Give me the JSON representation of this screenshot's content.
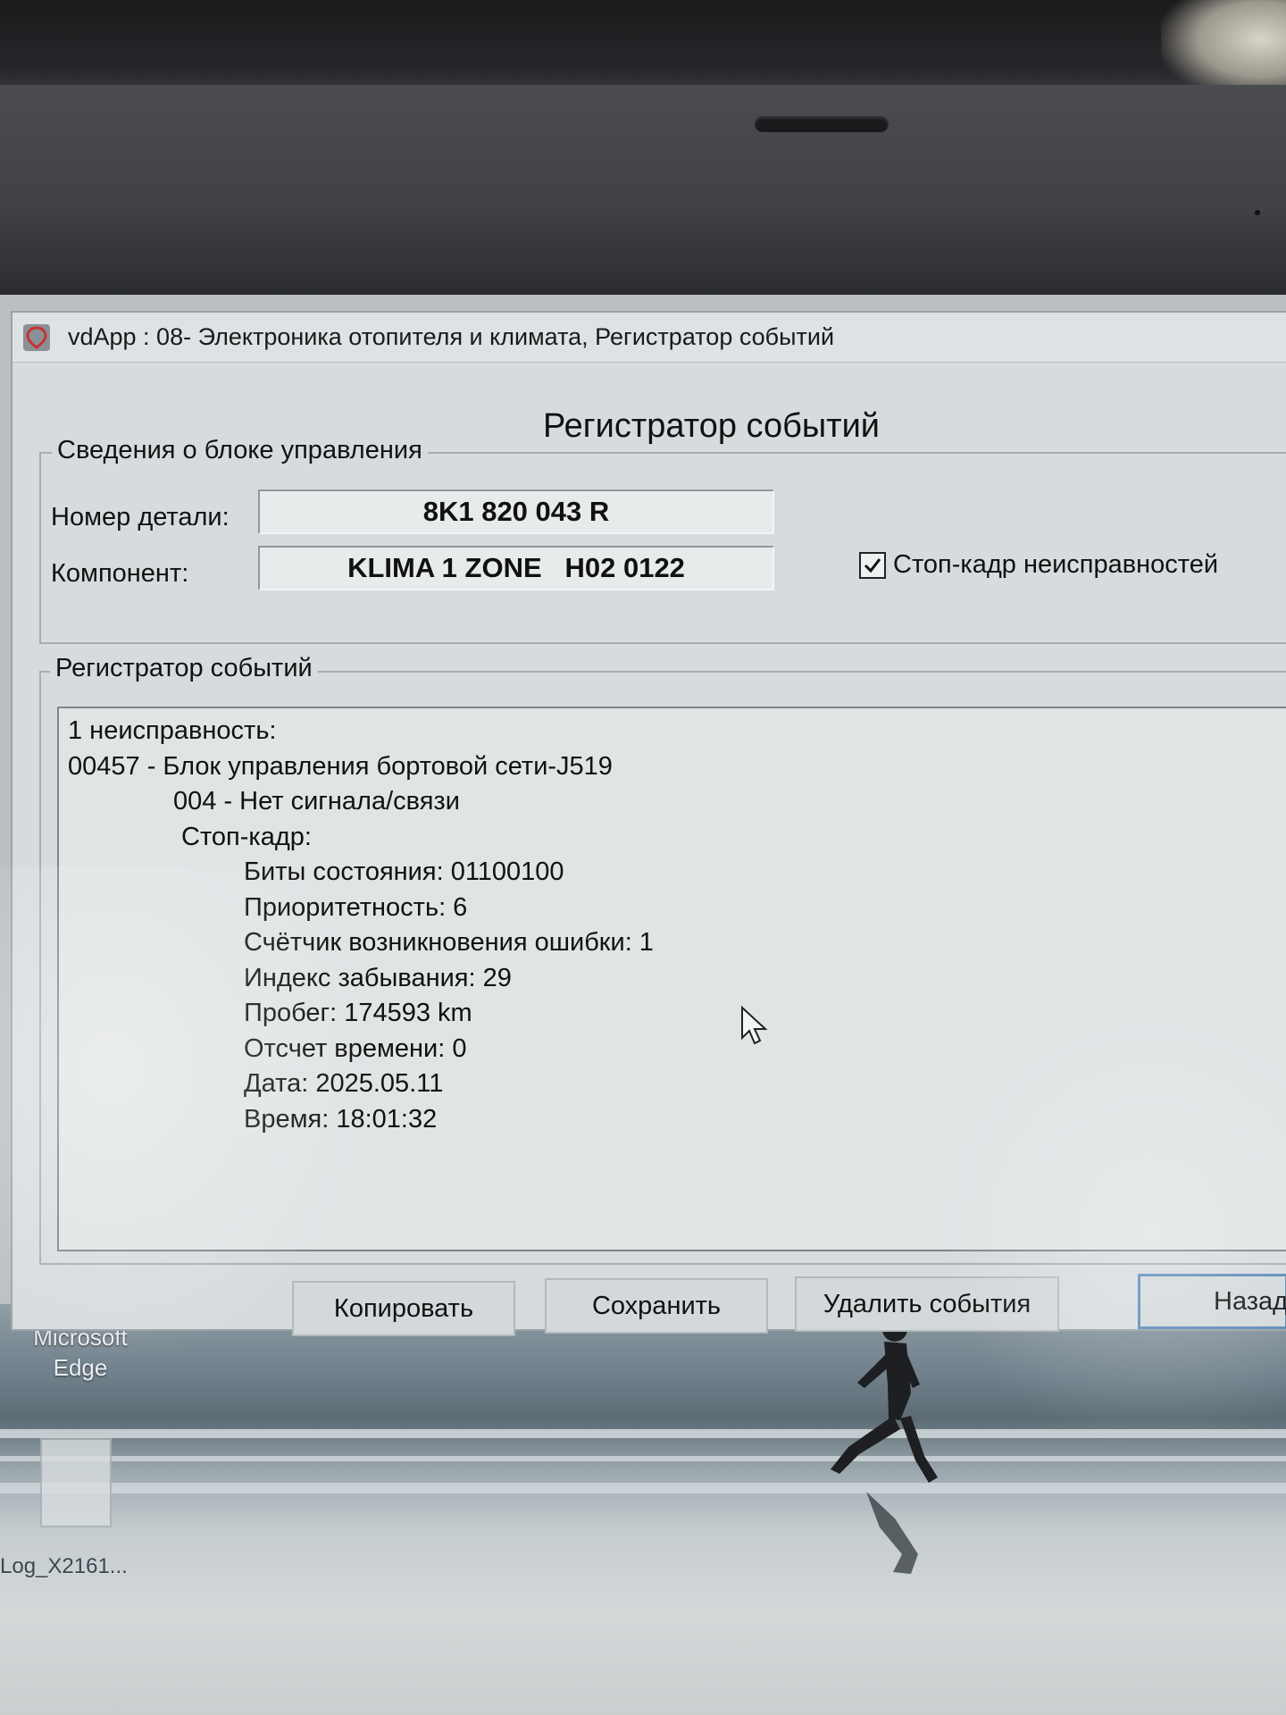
{
  "window": {
    "title": "vdApp : 08- Электроника отопителя и климата,  Регистратор событий"
  },
  "heading": "Регистратор событий",
  "control_unit": {
    "group_label": "Сведения о блоке управления",
    "part_number_label": "Номер детали:",
    "part_number_value": "8K1 820 043 R",
    "component_label": "Компонент:",
    "component_value": "KLIMA 1 ZONE   H02 0122",
    "freeze_frame_label": "Стоп-кадр неисправностей",
    "freeze_frame_checked": true
  },
  "event_log": {
    "group_label": "Регистратор событий",
    "lines": {
      "fault_count": "1 неисправность:",
      "fault_code": "00457 - Блок управления бортовой сети-J519",
      "fault_type": "004 - Нет сигнала/связи",
      "freeze_frame": "Стоп-кадр:",
      "status_bits": "Биты состояния: 01100100",
      "priority": "Приоритетность: 6",
      "occurrence_counter": "Счётчик возникновения ошибки: 1",
      "forget_index": "Индекс забывания: 29",
      "mileage": "Пробег: 174593 km",
      "time_count": "Отсчет времени: 0",
      "date": "Дата: 2025.05.11",
      "time": "Время: 18:01:32"
    }
  },
  "buttons": {
    "copy": "Копировать",
    "save": "Сохранить",
    "delete_events": "Удалить события",
    "back": "Назад"
  },
  "desktop": {
    "edge_label_line1": "Microsoft",
    "edge_label_line2": "Edge",
    "file_label": "Log_X2161..."
  },
  "colors": {
    "window_bg": "#d6dcde",
    "back_button_border": "#5b8bb8",
    "app_icon": "#c8322c"
  }
}
